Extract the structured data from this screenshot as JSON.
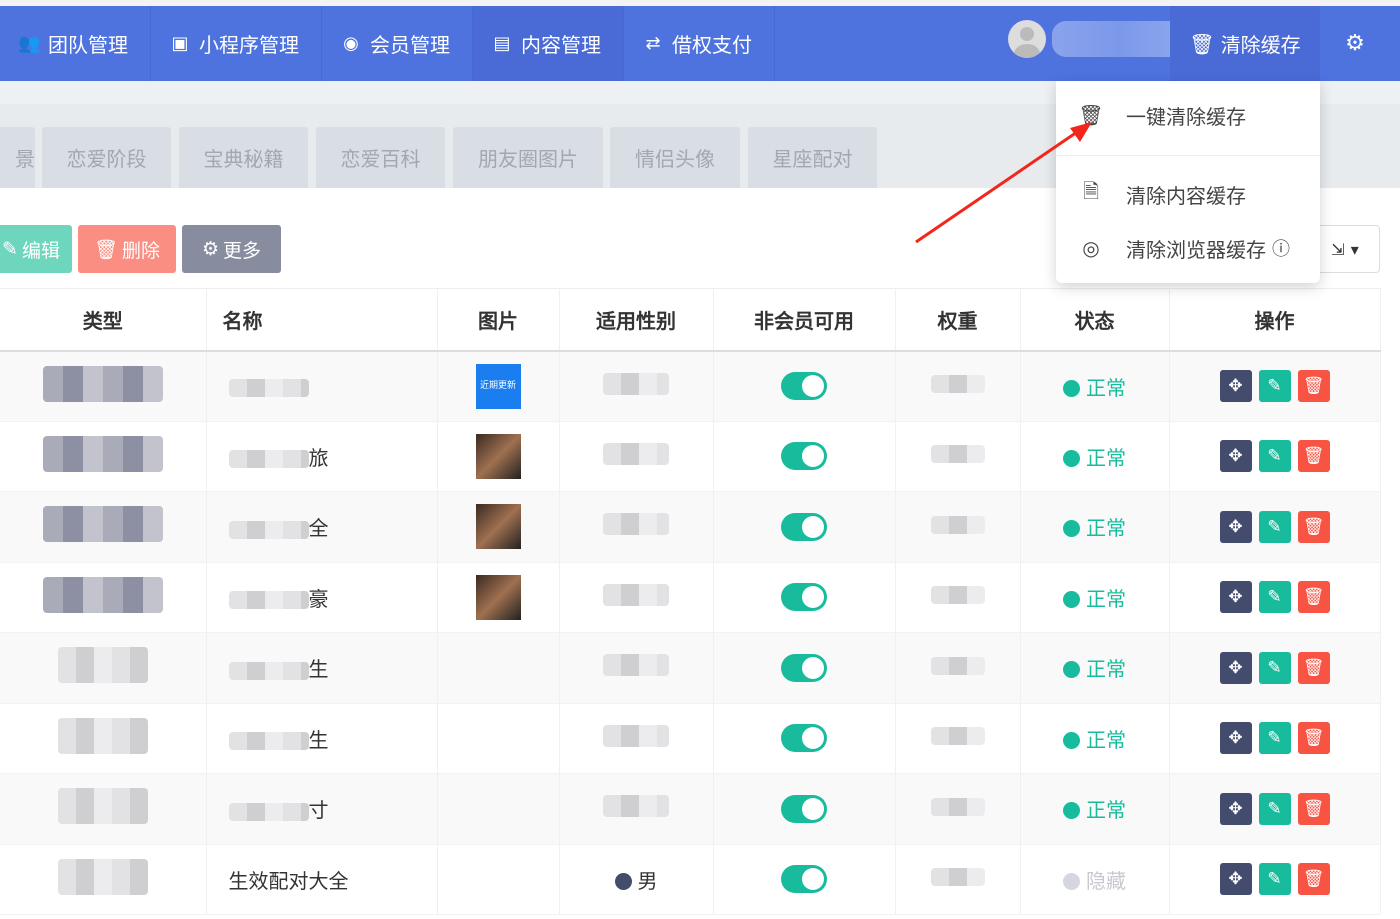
{
  "nav": {
    "items": [
      {
        "icon": "users-icon",
        "glyph": "👥",
        "label": "团队管理"
      },
      {
        "icon": "mp-icon",
        "glyph": "▣",
        "label": "小程序管理"
      },
      {
        "icon": "user-circle-icon",
        "glyph": "◉",
        "label": "会员管理"
      },
      {
        "icon": "newspaper-icon",
        "glyph": "▤",
        "label": "内容管理"
      },
      {
        "icon": "exchange-icon",
        "glyph": "⇄",
        "label": "借权支付"
      }
    ],
    "clear_cache": "清除缓存"
  },
  "dropdown": {
    "items": [
      "一键清除缓存",
      "清除内容缓存",
      "清除浏览器缓存"
    ]
  },
  "tabs": [
    "景",
    "恋爱阶段",
    "宝典秘籍",
    "恋爱百科",
    "朋友圈图片",
    "情侣头像",
    "星座配对"
  ],
  "toolbar": {
    "edit": "编辑",
    "delete": "删除",
    "more": "更多"
  },
  "table": {
    "headers": [
      "类型",
      "名称",
      "图片",
      "适用性别",
      "非会员可用",
      "权重",
      "状态",
      "操作"
    ],
    "rows": [
      {
        "name": "",
        "image": "近期更新",
        "gender": "",
        "status": "正常"
      },
      {
        "name": "旅",
        "image": "photo",
        "gender": "",
        "status": "正常"
      },
      {
        "name": "全",
        "image": "photo",
        "gender": "",
        "status": "正常"
      },
      {
        "name": "豪",
        "image": "photo",
        "gender": "",
        "status": "正常"
      },
      {
        "name": "生",
        "image": "",
        "gender": "",
        "status": "正常"
      },
      {
        "name": "生",
        "image": "",
        "gender": "",
        "status": "正常"
      },
      {
        "name": "寸",
        "image": "",
        "gender": "",
        "status": "正常"
      },
      {
        "name": "生效配对大全",
        "image": "",
        "gender": "男",
        "status": "隐藏",
        "type_suffix": "配对"
      }
    ]
  },
  "colors": {
    "nav": "#4e73df",
    "success": "#18bc9c",
    "danger": "#f75444",
    "dark": "#444c6e"
  }
}
